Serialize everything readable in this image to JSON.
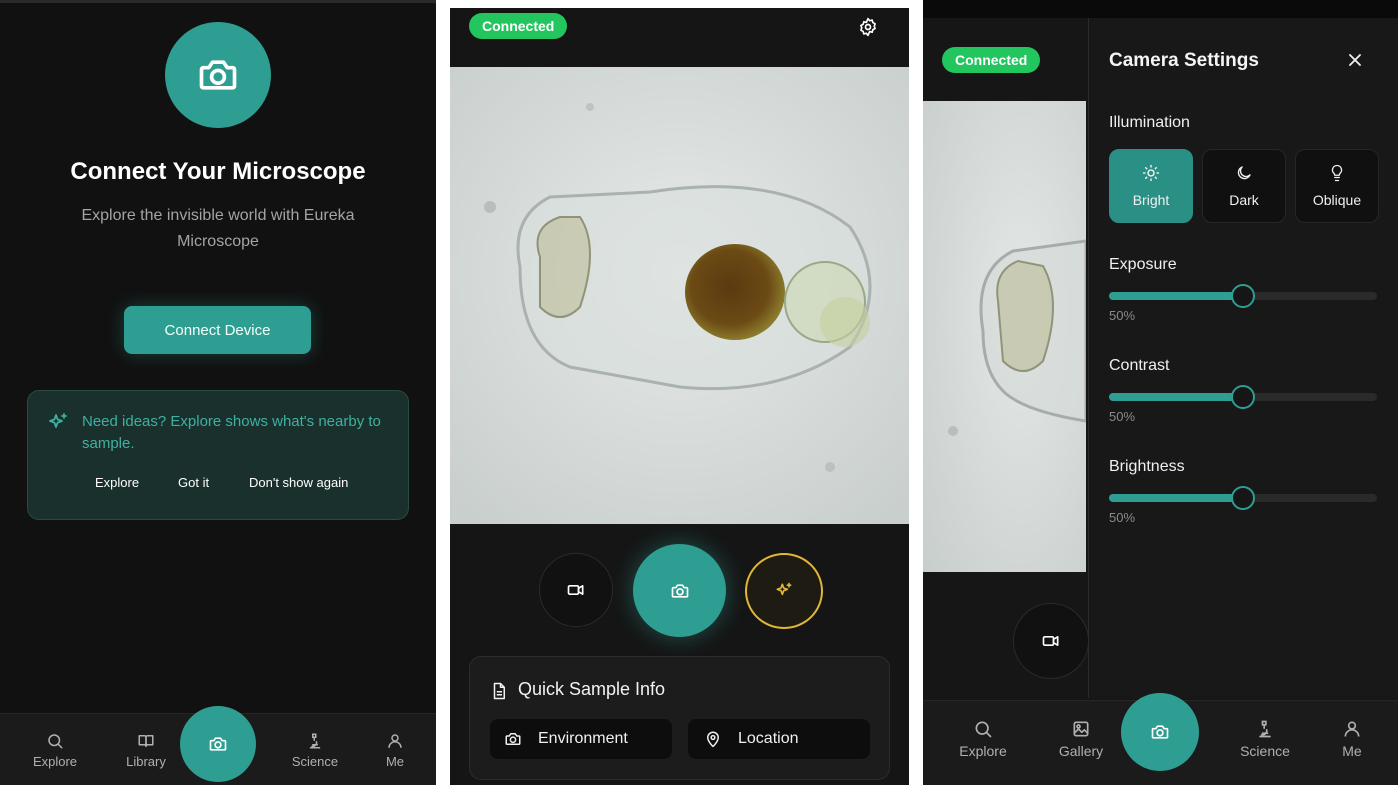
{
  "screen1": {
    "title": "Connect Your Microscope",
    "subtitle": "Explore the invisible world with Eureka Microscope",
    "connect_button": "Connect Device",
    "tip": {
      "text": "Need ideas? Explore shows what's nearby to sample.",
      "actions": [
        "Explore",
        "Got it",
        "Don't show again"
      ]
    },
    "nav": {
      "explore": "Explore",
      "library": "Library",
      "science": "Science",
      "me": "Me"
    }
  },
  "screen2": {
    "status": "Connected",
    "quick_sample": {
      "title": "Quick Sample Info",
      "environment": "Environment",
      "location": "Location"
    }
  },
  "screen3": {
    "status": "Connected",
    "panel_title": "Camera Settings",
    "illumination_label": "Illumination",
    "illumination_modes": [
      "Bright",
      "Dark",
      "Oblique"
    ],
    "illumination_selected": "Bright",
    "exposure": {
      "label": "Exposure",
      "value_text": "50%",
      "value": 0.5
    },
    "contrast": {
      "label": "Contrast",
      "value_text": "50%",
      "value": 0.5
    },
    "brightness": {
      "label": "Brightness",
      "value_text": "50%",
      "value": 0.5
    },
    "nav": {
      "explore": "Explore",
      "gallery": "Gallery",
      "science": "Science",
      "me": "Me"
    }
  },
  "colors": {
    "accent": "#2f9e92",
    "connected": "#22c55e",
    "highlight": "#e0b63a"
  }
}
